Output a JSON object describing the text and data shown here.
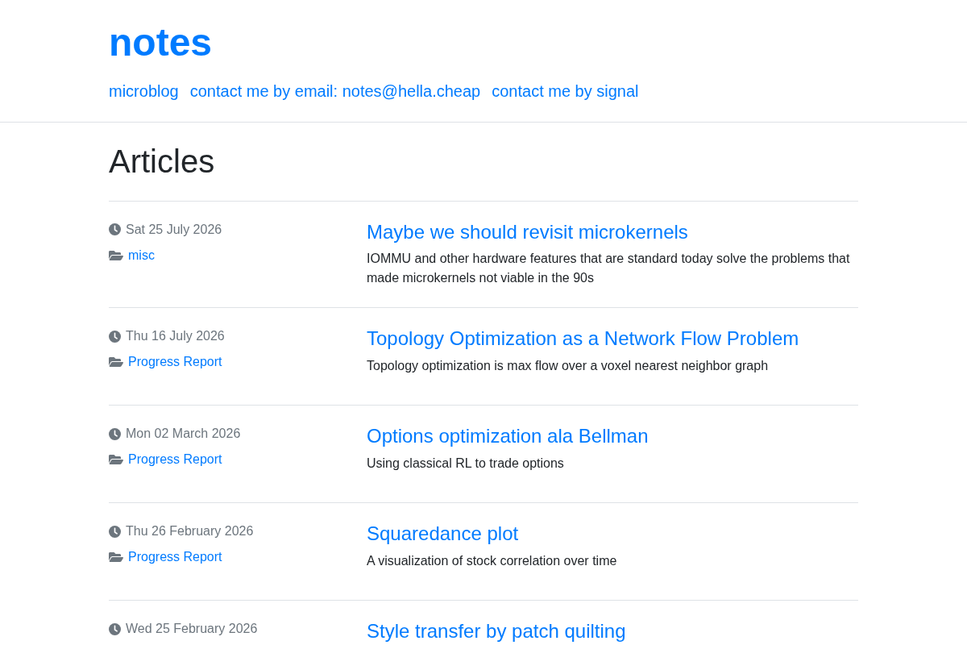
{
  "site": {
    "title": "notes",
    "nav": [
      "microblog",
      "contact me by email: notes@hella.cheap",
      "contact me by signal"
    ]
  },
  "heading": "Articles",
  "articles": [
    {
      "date": "Sat 25 July 2026",
      "category": "misc",
      "title": "Maybe we should revisit microkernels",
      "summary": "IOMMU and other hardware features that are standard today solve the problems that made microkernels not viable in the 90s"
    },
    {
      "date": "Thu 16 July 2026",
      "category": "Progress Report",
      "title": "Topology Optimization as a Network Flow Problem",
      "summary": "Topology optimization is max flow over a voxel nearest neighbor graph"
    },
    {
      "date": "Mon 02 March 2026",
      "category": "Progress Report",
      "title": "Options optimization ala Bellman",
      "summary": "Using classical RL to trade options"
    },
    {
      "date": "Thu 26 February 2026",
      "category": "Progress Report",
      "title": "Squaredance plot",
      "summary": "A visualization of stock correlation over time"
    },
    {
      "date": "Wed 25 February 2026",
      "title": "Style transfer by patch quilting"
    }
  ]
}
